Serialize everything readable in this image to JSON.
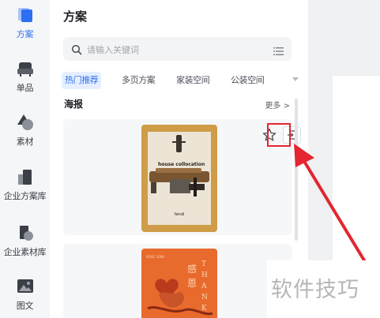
{
  "nav": {
    "items": [
      {
        "label": "方案",
        "icon": "layers-icon",
        "active": true
      },
      {
        "label": "单品",
        "icon": "sofa-icon"
      },
      {
        "label": "素材",
        "icon": "shapes-icon"
      },
      {
        "label": "企业方案库",
        "icon": "building-icon"
      },
      {
        "label": "企业素材库",
        "icon": "building-shapes-icon"
      },
      {
        "label": "图文",
        "icon": "image-icon"
      }
    ]
  },
  "panel": {
    "title": "方案",
    "search": {
      "placeholder": "请输入关键词"
    },
    "tabs": [
      {
        "label": "热门推荐",
        "active": true
      },
      {
        "label": "多页方案"
      },
      {
        "label": "家装空间"
      },
      {
        "label": "公装空间"
      }
    ],
    "section": {
      "title": "海报",
      "more": "更多 >"
    },
    "cards": [
      {
        "line1": "house collocation",
        "line2": "fendi"
      },
      {
        "line1": "ROOF 2008",
        "line2": "感恩 THANKS"
      }
    ]
  },
  "watermark": "软件技巧",
  "colors": {
    "accent": "#2d6ff0",
    "highlight": "#e3262f",
    "poster1": "#cf9d47",
    "poster2": "#e96a2d"
  }
}
